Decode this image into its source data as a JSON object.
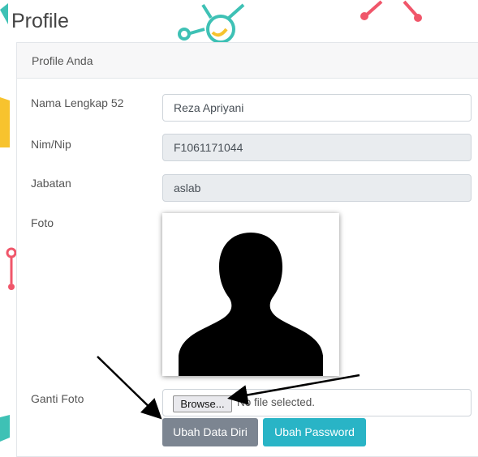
{
  "page": {
    "title": "Profile"
  },
  "card": {
    "header": "Profile Anda"
  },
  "form": {
    "nama_label": "Nama Lengkap 52",
    "nama_value": "Reza Apriyani",
    "nim_label": "Nim/Nip",
    "nim_value": "F1061171044",
    "jabatan_label": "Jabatan",
    "jabatan_value": "aslab",
    "foto_label": "Foto",
    "ganti_foto_label": "Ganti Foto",
    "browse_label": "Browse...",
    "file_status": "No file selected."
  },
  "buttons": {
    "ubah_data_diri": "Ubah Data Diri",
    "ubah_password": "Ubah Password"
  },
  "icons": {
    "photo": "avatar-silhouette-icon",
    "arrows": [
      "arrow-icon",
      "arrow-icon"
    ]
  },
  "colors": {
    "teal": "#29b4c6",
    "gray_button": "#7c8591",
    "decor_red": "#f0566a",
    "decor_yellow": "#f7c32e",
    "decor_teal": "#3ec1b5"
  }
}
